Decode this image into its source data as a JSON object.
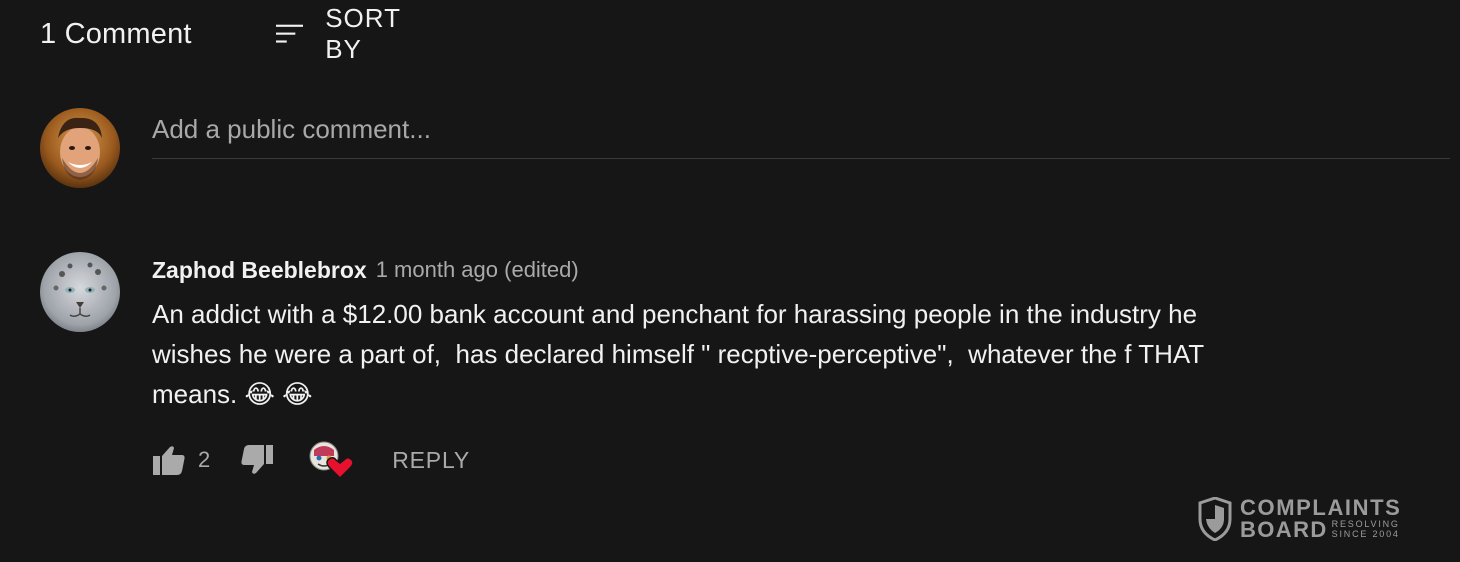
{
  "header": {
    "comment_count": "1 Comment",
    "sort_label": "SORT BY",
    "sort_icon": "sort-lines-icon"
  },
  "add_comment": {
    "placeholder": "Add a public comment...",
    "value": ""
  },
  "comment": {
    "author": "Zaphod Beeblebrox",
    "timestamp": "1 month ago (edited)",
    "text": "An addict with a $12.00 bank account and penchant for harassing people in the industry he\nwishes he were a part of,  has declared himself \" recptive-perceptive\",  whatever the f THAT\nmeans. 😂 😂",
    "like_count": "2",
    "reply_label": "REPLY",
    "icons": {
      "like": "thumbs-up-icon",
      "dislike": "thumbs-down-icon",
      "heart": "creator-heart-icon"
    }
  },
  "watermark": {
    "line1": "COMPLAINTS",
    "line2": "BOARD",
    "tag1": "RESOLVING",
    "tag2": "SINCE 2004"
  },
  "colors": {
    "background": "#161616",
    "primary_text": "#f1f1f1",
    "secondary_text": "#aaaaaa",
    "heart": "#e8112d"
  }
}
